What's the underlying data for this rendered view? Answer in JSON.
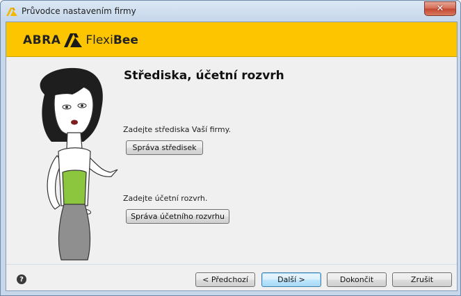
{
  "window": {
    "title": "Průvodce nastavením firmy",
    "close_label": "✕"
  },
  "banner": {
    "logo_abra": "ABRA",
    "logo_flexi": "Flexi",
    "logo_bee": "Bee",
    "background_color": "#fcc500"
  },
  "main": {
    "heading": "Střediska, účetní rozvrh",
    "cost_centers_prompt": "Zadejte střediska Vaší firmy.",
    "cost_centers_button": "Správa středisek",
    "chart_of_accounts_prompt": "Zadejte účetní rozvrh.",
    "chart_of_accounts_button": "Správa účetního rozvrhu"
  },
  "footer": {
    "help_label": "?",
    "previous_button": "< Předchozí",
    "next_button": "Další >",
    "finish_button": "Dokončit",
    "cancel_button": "Zrušit"
  },
  "icons": {
    "app": "abra-flexibee-icon",
    "help": "help-icon",
    "close": "close-icon"
  }
}
